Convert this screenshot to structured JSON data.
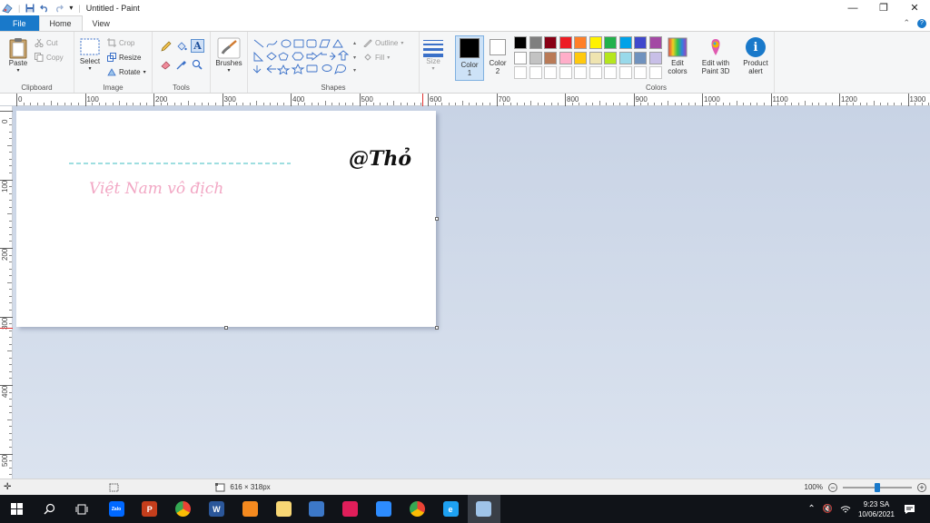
{
  "window": {
    "title": "Untitled - Paint",
    "minimize": "—",
    "restore": "❐",
    "close": "✕"
  },
  "menu": {
    "tabs": [
      "File",
      "Home",
      "View"
    ],
    "collapse_glyph": "⌃",
    "help_glyph": "?"
  },
  "ribbon": {
    "clipboard": {
      "label": "Clipboard",
      "paste": "Paste",
      "cut": "Cut",
      "copy": "Copy"
    },
    "image": {
      "label": "Image",
      "select": "Select",
      "crop": "Crop",
      "resize": "Resize",
      "rotate": "Rotate"
    },
    "tools": {
      "label": "Tools"
    },
    "brushes": {
      "label": "Brushes"
    },
    "shapes": {
      "label": "Shapes",
      "outline": "Outline",
      "fill": "Fill"
    },
    "size": {
      "label": "Size"
    },
    "color1": {
      "label": "Color",
      "sub": "1"
    },
    "color2": {
      "label": "Color",
      "sub": "2"
    },
    "colors": {
      "label": "Colors",
      "edit_colors": "Edit colors",
      "edit_paint3d": "Edit with Paint 3D",
      "product_alert": "Product alert",
      "palette_row1": [
        "#000000",
        "#7f7f7f",
        "#880015",
        "#ed1c24",
        "#ff7f27",
        "#fff200",
        "#22b14c",
        "#00a2e8",
        "#3f48cc",
        "#a349a4"
      ],
      "palette_row2": [
        "#ffffff",
        "#c3c3c3",
        "#b97a57",
        "#ffaec9",
        "#ffc90e",
        "#efe4b0",
        "#b5e61d",
        "#99d9ea",
        "#7092be",
        "#c8bfe7"
      ],
      "palette_row3_count": 10,
      "color1_value": "#000000",
      "color2_value": "#ffffff"
    }
  },
  "rulers": {
    "horizontal": [
      "0",
      "100",
      "200",
      "300",
      "400",
      "500",
      "600",
      "700",
      "800",
      "900",
      "1000",
      "1100",
      "1200",
      "1300"
    ],
    "vertical": [
      "0",
      "100",
      "200",
      "300",
      "400",
      "500"
    ]
  },
  "canvas": {
    "signature": "@Thỏ",
    "caption": "Việt Nam vô địch",
    "dashed_line_color": "#7fd3d6",
    "caption_color": "#f2a7c4"
  },
  "status": {
    "dimensions": "616 × 318px",
    "zoom": "100%",
    "zoom_fraction": 0.5
  },
  "taskbar": {
    "time": "9:23 SA",
    "date": "10/06/2021",
    "apps": [
      {
        "name": "zalo",
        "glyph": "Zalo",
        "color": "#0068ff"
      },
      {
        "name": "powerpoint",
        "glyph": "P",
        "color": "#c43e1c"
      },
      {
        "name": "chrome",
        "glyph": "",
        "color": "#fbbc05"
      },
      {
        "name": "word",
        "glyph": "W",
        "color": "#2b579a"
      },
      {
        "name": "orange-app",
        "glyph": "",
        "color": "#f58a1f"
      },
      {
        "name": "file-explorer",
        "glyph": "",
        "color": "#f8d775"
      },
      {
        "name": "tools-app",
        "glyph": "",
        "color": "#3c78c8"
      },
      {
        "name": "slack",
        "glyph": "",
        "color": "#e01e5a"
      },
      {
        "name": "zoom",
        "glyph": "",
        "color": "#2d8cff"
      },
      {
        "name": "chrome-2",
        "glyph": "",
        "color": "#34a853"
      },
      {
        "name": "internet-explorer",
        "glyph": "e",
        "color": "#1ea1f1"
      },
      {
        "name": "paint",
        "glyph": "",
        "color": "#9fc3e8"
      }
    ]
  }
}
